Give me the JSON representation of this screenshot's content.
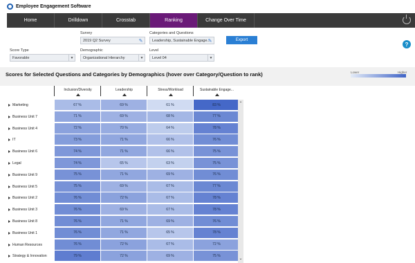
{
  "app": {
    "title": "Employee Engagement Software",
    "logo_icon": "logo-icon"
  },
  "nav": {
    "tabs": [
      {
        "label": "Home",
        "active": false
      },
      {
        "label": "Drilldown",
        "active": false
      },
      {
        "label": "Crosstab",
        "active": false
      },
      {
        "label": "Ranking",
        "active": true
      },
      {
        "label": "Change Over Time",
        "active": false
      }
    ],
    "power_icon": "power-icon"
  },
  "filters": {
    "survey": {
      "label": "Survey",
      "value": "2019 Q2 Survey"
    },
    "categories": {
      "label": "Categories and Questions",
      "value": "Leadership, Sustainable Engage..."
    },
    "score_type": {
      "label": "Score Type",
      "value": "Favorable"
    },
    "demographic": {
      "label": "Demographic",
      "value": "Organizational Hierarchy"
    },
    "level": {
      "label": "Level",
      "value": "Level 04"
    },
    "export_label": "Export",
    "help_label": "?"
  },
  "panel": {
    "title": "Scores for Selected Questions and Categories by Demographics (hover over Category/Question  to rank)",
    "legend_lower": "Lower",
    "legend_higher": "Higher"
  },
  "columns": [
    "Inclusion/Diversity",
    "Leadership",
    "Stress/Workload",
    "Sustainable Engage..."
  ],
  "rows": [
    {
      "label": "Marketing",
      "values": [
        "67 %",
        "69 %",
        "61 %",
        "83 %"
      ],
      "scores": [
        67,
        69,
        61,
        83
      ]
    },
    {
      "label": "Business Unit 7",
      "values": [
        "71 %",
        "69 %",
        "68 %",
        "77 %"
      ],
      "scores": [
        71,
        69,
        68,
        77
      ]
    },
    {
      "label": "Business Unit 4",
      "values": [
        "72 %",
        "70 %",
        "64 %",
        "78 %"
      ],
      "scores": [
        72,
        70,
        64,
        78
      ]
    },
    {
      "label": "IT",
      "values": [
        "73 %",
        "71 %",
        "66 %",
        "76 %"
      ],
      "scores": [
        73,
        71,
        66,
        76
      ]
    },
    {
      "label": "Business Unit 6",
      "values": [
        "74 %",
        "71 %",
        "66 %",
        "75 %"
      ],
      "scores": [
        74,
        71,
        66,
        75
      ]
    },
    {
      "label": "Legal",
      "values": [
        "74 %",
        "65 %",
        "63 %",
        "75 %"
      ],
      "scores": [
        74,
        65,
        63,
        75
      ]
    },
    {
      "label": "Business Unit 9",
      "values": [
        "75 %",
        "71 %",
        "69 %",
        "76 %"
      ],
      "scores": [
        75,
        71,
        69,
        76
      ]
    },
    {
      "label": "Business Unit 5",
      "values": [
        "75 %",
        "69 %",
        "67 %",
        "77 %"
      ],
      "scores": [
        75,
        69,
        67,
        77
      ]
    },
    {
      "label": "Business Unit 2",
      "values": [
        "76 %",
        "72 %",
        "67 %",
        "78 %"
      ],
      "scores": [
        76,
        72,
        67,
        78
      ]
    },
    {
      "label": "Business Unit 3",
      "values": [
        "76 %",
        "69 %",
        "67 %",
        "78 %"
      ],
      "scores": [
        76,
        69,
        67,
        78
      ]
    },
    {
      "label": "Business Unit 8",
      "values": [
        "76 %",
        "71 %",
        "69 %",
        "76 %"
      ],
      "scores": [
        76,
        71,
        69,
        76
      ]
    },
    {
      "label": "Business Unit 1",
      "values": [
        "76 %",
        "71 %",
        "65 %",
        "78 %"
      ],
      "scores": [
        76,
        71,
        65,
        78
      ]
    },
    {
      "label": "Human Resources",
      "values": [
        "76 %",
        "72 %",
        "67 %",
        "72 %"
      ],
      "scores": [
        76,
        72,
        67,
        72
      ]
    },
    {
      "label": "Strategy & Innovation",
      "values": [
        "79 %",
        "72 %",
        "69 %",
        "75 %"
      ],
      "scores": [
        79,
        72,
        69,
        75
      ]
    }
  ],
  "colors": {
    "nav_bg": "#3a3a3a",
    "nav_active": "#6a1a78",
    "accent": "#2a7fd4",
    "heat_low": "#e3ebf8",
    "heat_high": "#3f63c6"
  }
}
